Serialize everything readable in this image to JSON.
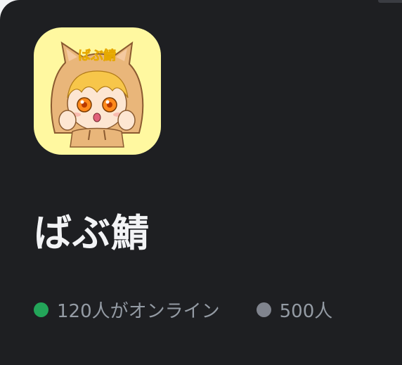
{
  "server": {
    "name": "ばぶ鯖",
    "icon": "chibi-cat-hood-avatar",
    "icon_text": "ばぶ鯖",
    "icon_bg": "#fff8a0"
  },
  "stats": {
    "online": {
      "label": "120人がオンライン",
      "dot_color": "#23a559"
    },
    "members": {
      "label": "500人",
      "dot_color": "#80848e"
    }
  },
  "theme": {
    "background": "#1e1f22",
    "name_color": "#f2f3f5",
    "muted_text": "#949ba4"
  }
}
